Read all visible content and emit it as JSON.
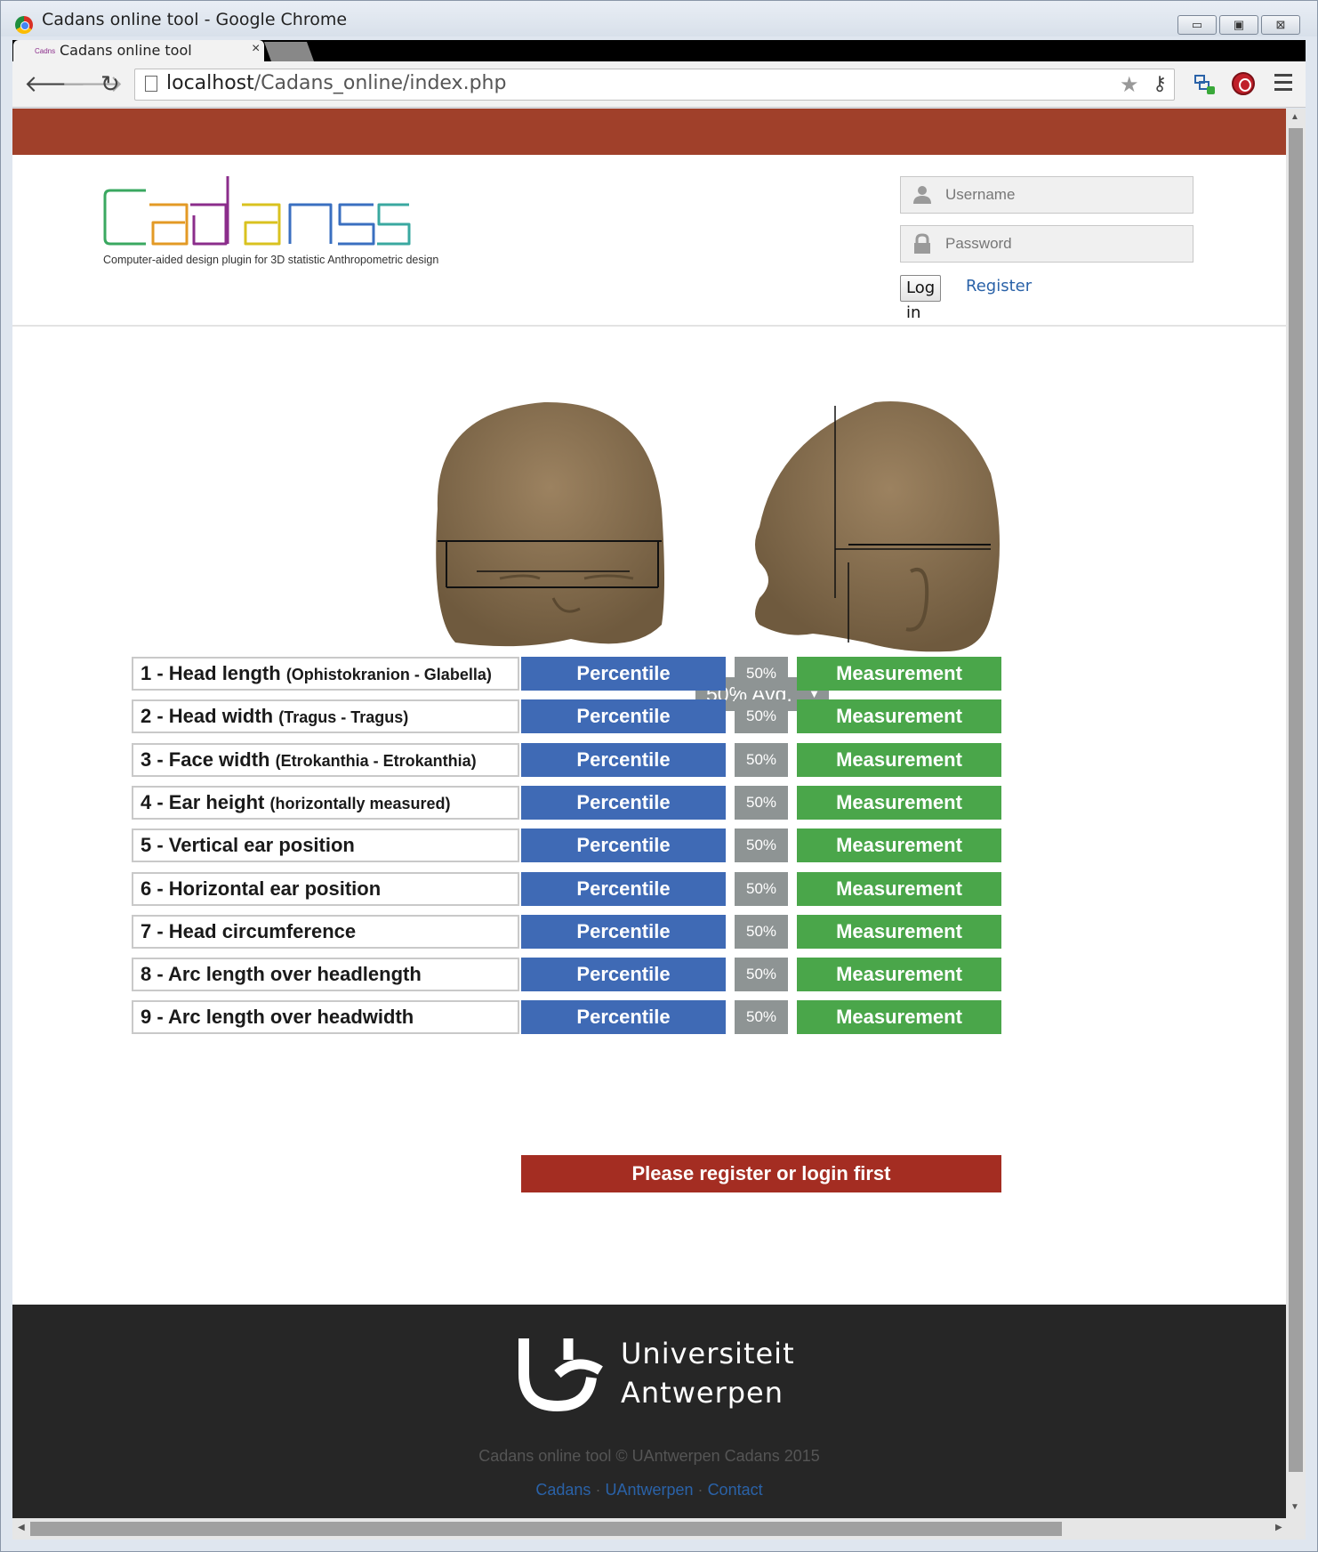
{
  "window": {
    "title": "Cadans online tool - Google Chrome",
    "controls": {
      "minimize": "▭",
      "maximize": "▣",
      "close": "⊠"
    }
  },
  "tab": {
    "title": "Cadans online tool",
    "close": "×",
    "favicon_text": "Cadns"
  },
  "toolbar": {
    "url_host": "localhost",
    "url_path": "/Cadans_online/index.php",
    "icons": [
      "back-icon",
      "forward-icon",
      "reload-icon",
      "bookmark-star-icon",
      "key-icon",
      "extension-icon",
      "stop-icon",
      "menu-icon"
    ]
  },
  "header": {
    "logo_text": "Cadans",
    "logo_tagline": "Computer-aided design plugin for 3D statistic Anthropometric design",
    "username_placeholder": "Username",
    "password_placeholder": "Password",
    "login_label": "Log in",
    "register_label": "Register"
  },
  "main": {
    "avg_select": {
      "selected": "50% Avg.",
      "caret": "▼"
    },
    "rows": [
      {
        "label": "1 - Head length",
        "detail": "(Ophistokranion - Glabella)",
        "percentile_label": "Percentile",
        "percent": "50%",
        "measurement_label": "Measurement"
      },
      {
        "label": "2 - Head width",
        "detail": "(Tragus - Tragus)",
        "percentile_label": "Percentile",
        "percent": "50%",
        "measurement_label": "Measurement"
      },
      {
        "label": "3 - Face width",
        "detail": "(Etrokanthia - Etrokanthia)",
        "percentile_label": "Percentile",
        "percent": "50%",
        "measurement_label": "Measurement"
      },
      {
        "label": "4 - Ear height",
        "detail": "(horizontally measured)",
        "percentile_label": "Percentile",
        "percent": "50%",
        "measurement_label": "Measurement"
      },
      {
        "label": "5 - Vertical ear position",
        "detail": "",
        "percentile_label": "Percentile",
        "percent": "50%",
        "measurement_label": "Measurement"
      },
      {
        "label": "6 - Horizontal ear position",
        "detail": "",
        "percentile_label": "Percentile",
        "percent": "50%",
        "measurement_label": "Measurement"
      },
      {
        "label": "7 - Head circumference",
        "detail": "",
        "percentile_label": "Percentile",
        "percent": "50%",
        "measurement_label": "Measurement"
      },
      {
        "label": "8 - Arc length over headlength",
        "detail": "",
        "percentile_label": "Percentile",
        "percent": "50%",
        "measurement_label": "Measurement"
      },
      {
        "label": "9 - Arc length over headwidth",
        "detail": "",
        "percentile_label": "Percentile",
        "percent": "50%",
        "measurement_label": "Measurement"
      }
    ],
    "register_notice": "Please register or login first"
  },
  "footer": {
    "university_line1": "Universiteit",
    "university_line2": "Antwerpen",
    "copyright": "Cadans online tool © UAntwerpen Cadans 2015",
    "links": [
      "Cadans",
      "UAntwerpen",
      "Contact"
    ],
    "separator": "·"
  },
  "colors": {
    "top_bar": "#a0402a",
    "percentile_button": "#3f6ab5",
    "percent_badge": "#8e9494",
    "measurement_button": "#4aa64a",
    "register_notice": "#a42d22",
    "footer_bg": "#262626",
    "link": "#2a62a8",
    "head_skin": "#8c7250"
  }
}
